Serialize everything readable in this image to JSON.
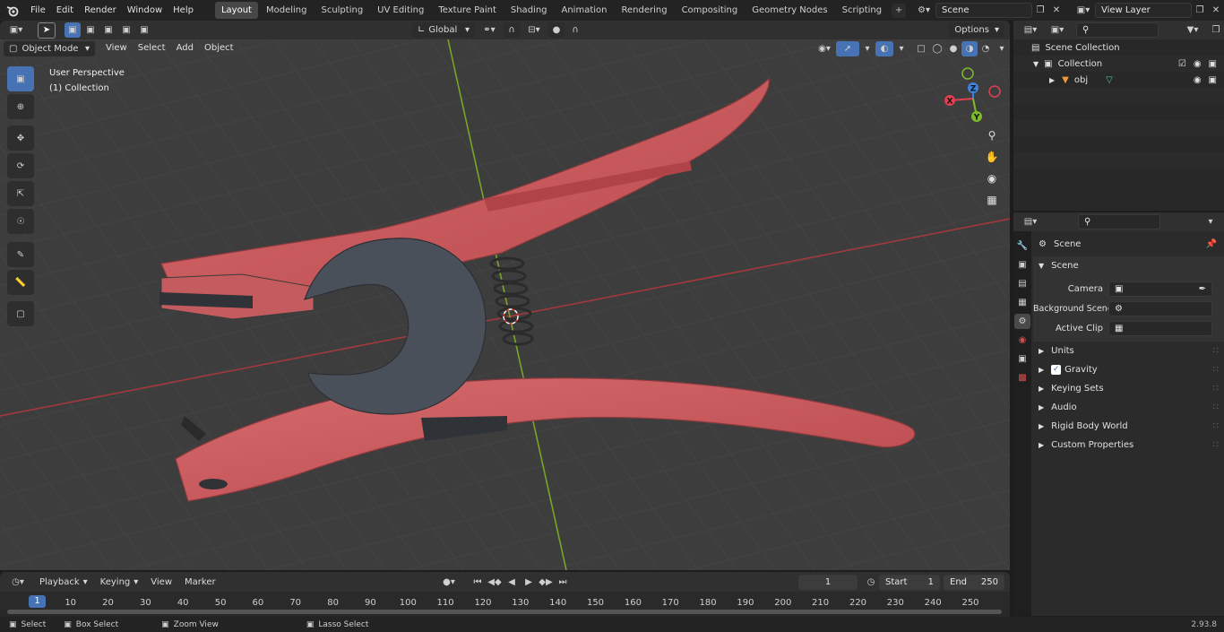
{
  "topbar": {
    "menus": [
      "File",
      "Edit",
      "Render",
      "Window",
      "Help"
    ],
    "workspaces": [
      "Layout",
      "Modeling",
      "Sculpting",
      "UV Editing",
      "Texture Paint",
      "Shading",
      "Animation",
      "Rendering",
      "Compositing",
      "Geometry Nodes",
      "Scripting"
    ],
    "active_workspace": "Layout",
    "scene_name": "Scene",
    "view_layer": "View Layer"
  },
  "viewport_toolbar": {
    "transform_orientation": "Global",
    "options_label": "Options"
  },
  "viewport_header": {
    "mode": "Object Mode",
    "menus": [
      "View",
      "Select",
      "Add",
      "Object"
    ]
  },
  "viewport": {
    "perspective_label": "User Perspective",
    "collection_label": "(1) Collection",
    "gizmo_axes": {
      "x": "X",
      "y": "Y",
      "z": "Z"
    },
    "object_color": "#c85a5d"
  },
  "outliner": {
    "root": "Scene Collection",
    "collection": "Collection",
    "object": "obj"
  },
  "properties": {
    "context_title": "Scene",
    "section_title": "Scene",
    "fields": {
      "camera_label": "Camera",
      "background_scene_label": "Background Scene",
      "active_clip_label": "Active Clip"
    },
    "panels": [
      "Units",
      "Gravity",
      "Keying Sets",
      "Audio",
      "Rigid Body World",
      "Custom Properties"
    ]
  },
  "timeline": {
    "menus": [
      "Playback",
      "Keying",
      "View",
      "Marker"
    ],
    "current_frame": "1",
    "start_label": "Start",
    "start_value": "1",
    "end_label": "End",
    "end_value": "250",
    "ticks": [
      "1",
      "10",
      "20",
      "30",
      "40",
      "50",
      "60",
      "70",
      "80",
      "90",
      "100",
      "110",
      "120",
      "130",
      "140",
      "150",
      "160",
      "170",
      "180",
      "190",
      "200",
      "210",
      "220",
      "230",
      "240",
      "250"
    ]
  },
  "statusbar": {
    "select": "Select",
    "box_select": "Box Select",
    "zoom_view": "Zoom View",
    "lasso_select": "Lasso Select",
    "version": "2.93.8"
  }
}
